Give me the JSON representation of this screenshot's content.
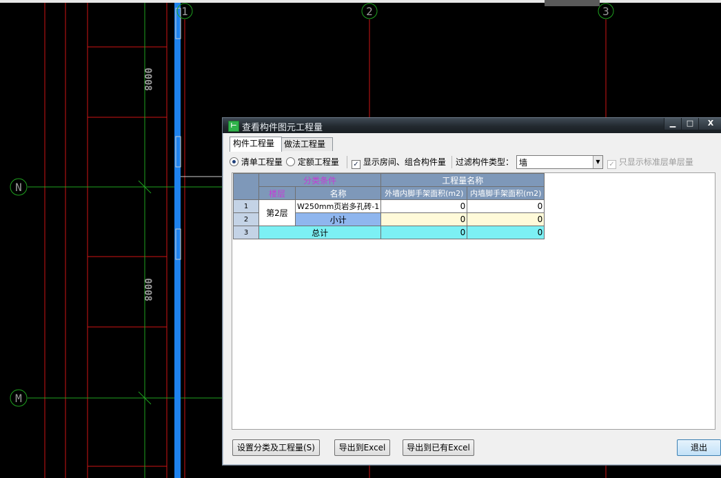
{
  "cad": {
    "axis_labels": {
      "a1": "1",
      "a2": "2",
      "a3": "3",
      "aN": "N",
      "aM": "M"
    },
    "dim_labels": {
      "d1": "0008",
      "d2": "0008"
    }
  },
  "dialog": {
    "title": "查看构件图元工程量",
    "window_buttons": {
      "minimize": "▁",
      "maximize": "□",
      "close": "X"
    },
    "tabs": [
      "构件工程量",
      "做法工程量"
    ],
    "toolbar": {
      "radio_list": "清单工程量",
      "radio_quota": "定额工程量",
      "checkbox_show_rooms": "显示房间、组合构件量",
      "checkbox_show_rooms_mark": "✓",
      "filter_label": "过滤构件类型：",
      "filter_value": "墙",
      "filter_arrow": "▼",
      "checkbox_std_floor": "只显示标准层单层量",
      "checkbox_std_floor_mark": "✓"
    },
    "table": {
      "group_header_left": "分类条件",
      "group_header_right": "工程量名称",
      "col_floor": "楼层",
      "col_name": "名称",
      "col_outer": "外墙内脚手架面积(m2)",
      "col_inner": "内墙脚手架面积(m2)",
      "rows": [
        {
          "num": "1",
          "floor": "第2层",
          "name": "W250mm页岩多孔砖-1",
          "outer": "0",
          "inner": "0"
        },
        {
          "num": "2",
          "name": "小计",
          "outer": "0",
          "inner": "0"
        },
        {
          "num": "3",
          "name": "总计",
          "outer": "0",
          "inner": "0"
        }
      ]
    },
    "buttons": {
      "settings": "设置分类及工程量(S)",
      "export_excel": "导出到Excel",
      "export_existing": "导出到已有Excel",
      "exit": "退出"
    }
  }
}
